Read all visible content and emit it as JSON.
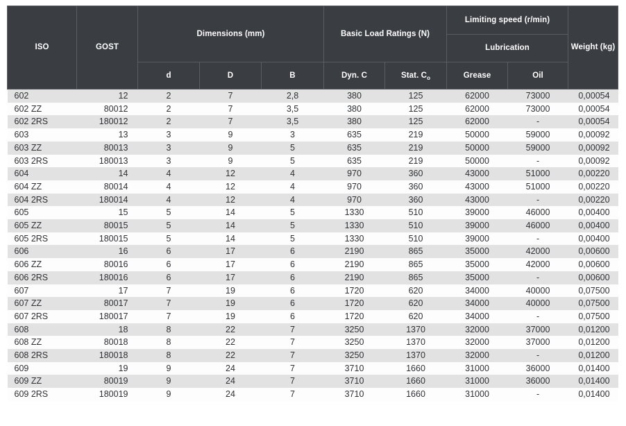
{
  "table": {
    "header": {
      "iso": "ISO",
      "gost": "GOST",
      "dimensions_group": "Dimensions (mm)",
      "basic_load_group": "Basic Load Ratings (N)",
      "limiting_speed_group": "Limiting speed (r/min)",
      "lubrication_group": "Lubrication",
      "weight": "Weight (kg)",
      "d": "d",
      "D": "D",
      "B": "B",
      "dyn_c": "Dyn. C",
      "stat_c_main": "Stat. C",
      "stat_c_sub": "o",
      "grease": "Grease",
      "oil": "Oil"
    },
    "columns": [
      "ISO",
      "GOST",
      "d",
      "D",
      "B",
      "Dyn. C",
      "Stat. Co",
      "Grease",
      "Oil",
      "Weight (kg)"
    ],
    "rows": [
      [
        "602",
        "12",
        "2",
        "7",
        "2,8",
        "380",
        "125",
        "62000",
        "73000",
        "0,00054"
      ],
      [
        "602 ZZ",
        "80012",
        "2",
        "7",
        "3,5",
        "380",
        "125",
        "62000",
        "73000",
        "0,00054"
      ],
      [
        "602 2RS",
        "180012",
        "2",
        "7",
        "3,5",
        "380",
        "125",
        "62000",
        "-",
        "0,00054"
      ],
      [
        "603",
        "13",
        "3",
        "9",
        "3",
        "635",
        "219",
        "50000",
        "59000",
        "0,00092"
      ],
      [
        "603 ZZ",
        "80013",
        "3",
        "9",
        "5",
        "635",
        "219",
        "50000",
        "59000",
        "0,00092"
      ],
      [
        "603 2RS",
        "180013",
        "3",
        "9",
        "5",
        "635",
        "219",
        "50000",
        "-",
        "0,00092"
      ],
      [
        "604",
        "14",
        "4",
        "12",
        "4",
        "970",
        "360",
        "43000",
        "51000",
        "0,00220"
      ],
      [
        "604  ZZ",
        "80014",
        "4",
        "12",
        "4",
        "970",
        "360",
        "43000",
        "51000",
        "0,00220"
      ],
      [
        "604 2RS",
        "180014",
        "4",
        "12",
        "4",
        "970",
        "360",
        "43000",
        "-",
        "0,00220"
      ],
      [
        "605",
        "15",
        "5",
        "14",
        "5",
        "1330",
        "510",
        "39000",
        "46000",
        "0,00400"
      ],
      [
        "605 ZZ",
        "80015",
        "5",
        "14",
        "5",
        "1330",
        "510",
        "39000",
        "46000",
        "0,00400"
      ],
      [
        "605 2RS",
        "180015",
        "5",
        "14",
        "5",
        "1330",
        "510",
        "39000",
        "-",
        "0,00400"
      ],
      [
        "606",
        "16",
        "6",
        "17",
        "6",
        "2190",
        "865",
        "35000",
        "42000",
        "0,00600"
      ],
      [
        "606 ZZ",
        "80016",
        "6",
        "17",
        "6",
        "2190",
        "865",
        "35000",
        "42000",
        "0,00600"
      ],
      [
        "606 2RS",
        "180016",
        "6",
        "17",
        "6",
        "2190",
        "865",
        "35000",
        "-",
        "0,00600"
      ],
      [
        "607",
        "17",
        "7",
        "19",
        "6",
        "1720",
        "620",
        "34000",
        "40000",
        "0,07500"
      ],
      [
        "607 ZZ",
        "80017",
        "7",
        "19",
        "6",
        "1720",
        "620",
        "34000",
        "40000",
        "0,07500"
      ],
      [
        "607 2RS",
        "180017",
        "7",
        "19",
        "6",
        "1720",
        "620",
        "34000",
        "-",
        "0,07500"
      ],
      [
        "608",
        "18",
        "8",
        "22",
        "7",
        "3250",
        "1370",
        "32000",
        "37000",
        "0,01200"
      ],
      [
        "608 ZZ",
        "80018",
        "8",
        "22",
        "7",
        "3250",
        "1370",
        "32000",
        "37000",
        "0,01200"
      ],
      [
        "608 2RS",
        "180018",
        "8",
        "22",
        "7",
        "3250",
        "1370",
        "32000",
        "-",
        "0,01200"
      ],
      [
        "609",
        "19",
        "9",
        "24",
        "7",
        "3710",
        "1660",
        "31000",
        "36000",
        "0,01400"
      ],
      [
        "609 ZZ",
        "80019",
        "9",
        "24",
        "7",
        "3710",
        "1660",
        "31000",
        "36000",
        "0,01400"
      ],
      [
        "609 2RS",
        "180019",
        "9",
        "24",
        "7",
        "3710",
        "1660",
        "31000",
        "-",
        "0,01400"
      ]
    ]
  },
  "colors": {
    "header_bg": "#3a3d42",
    "header_border": "#5a5d62",
    "header_text": "#ffffff",
    "row_odd_bg": "#e2e2e2",
    "row_even_bg": "#fdfdfd",
    "body_text": "#2f3034",
    "page_bg": "#ffffff"
  }
}
